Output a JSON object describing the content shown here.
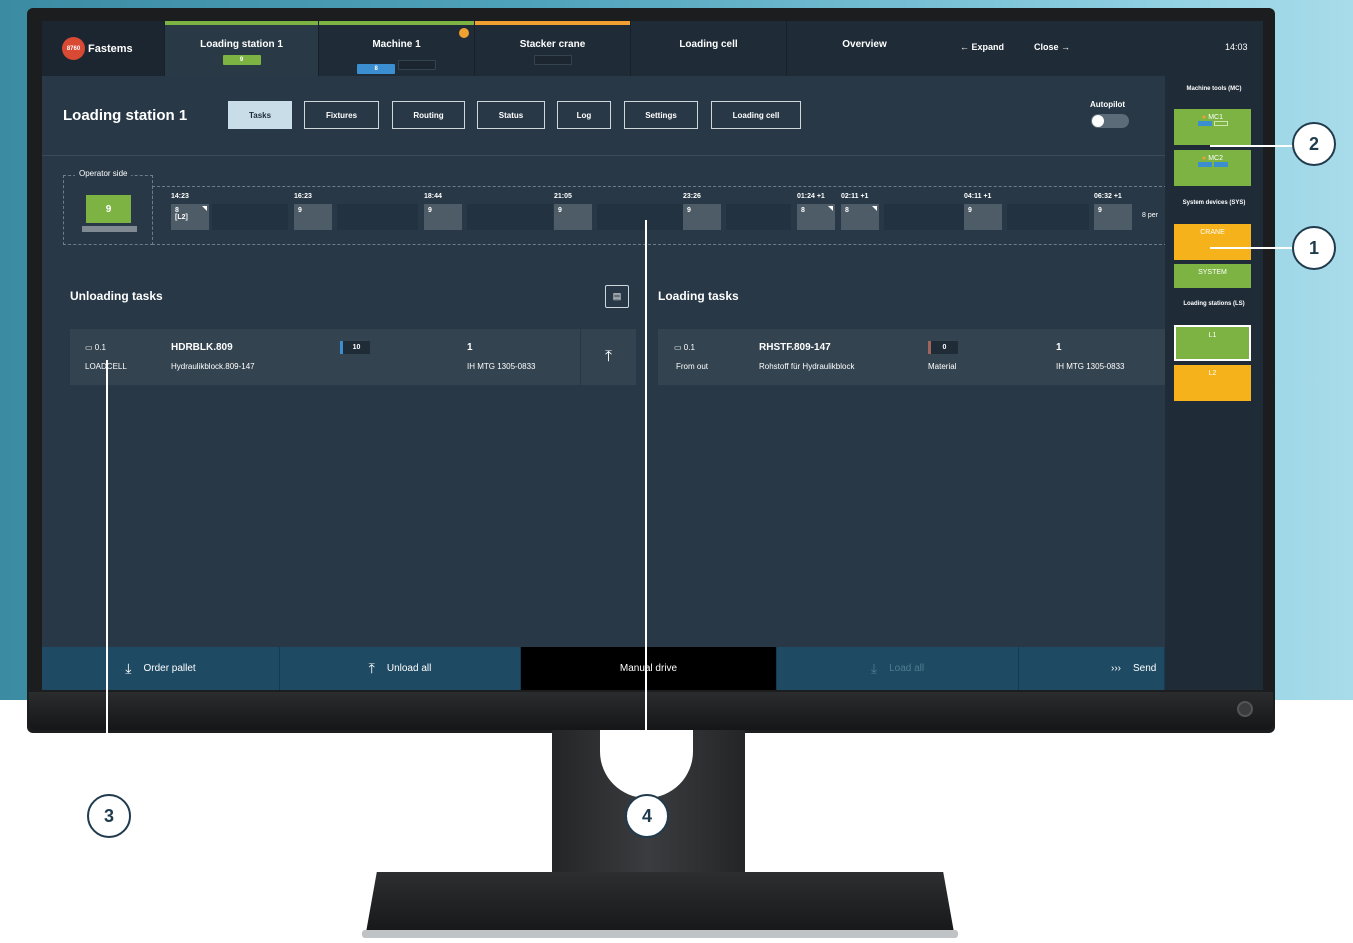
{
  "app": {
    "logo_text": "Fastems",
    "logo_badge": "8760"
  },
  "tabs": [
    {
      "label": "Loading station 1",
      "chip": "9",
      "accent": "#7cb342"
    },
    {
      "label": "Machine 1",
      "chip": "8",
      "accent": "#7cb342"
    },
    {
      "label": "Stacker crane",
      "chip": "",
      "accent": "#f0a031"
    },
    {
      "label": "Loading cell",
      "chip": ""
    },
    {
      "label": "Overview",
      "chip": ""
    }
  ],
  "nav": {
    "expand": "←  Expand",
    "close": "Close  →",
    "time": "14:03"
  },
  "header": {
    "title": "Loading station 1",
    "buttons": [
      "Tasks",
      "Fixtures",
      "Routing",
      "Status",
      "Log",
      "Settings",
      "Loading cell"
    ],
    "autopilot": "Autopilot",
    "autopilot_on": false
  },
  "timeline": {
    "operator_label": "Operator side",
    "operator_value": "9",
    "slots": [
      {
        "time": "14:23",
        "value": "8",
        "sub": "[L2]"
      },
      {
        "time": "16:23",
        "value": "9",
        "sub": ""
      },
      {
        "time": "18:44",
        "value": "9",
        "sub": ""
      },
      {
        "time": "21:05",
        "value": "9",
        "sub": ""
      },
      {
        "time": "23:26",
        "value": "9",
        "sub": ""
      },
      {
        "time": "01:24 +1",
        "value": "8",
        "sub": ""
      },
      {
        "time": "02:11 +1",
        "value": "8",
        "sub": ""
      },
      {
        "time": "04:11 +1",
        "value": "9",
        "sub": ""
      },
      {
        "time": "06:32 +1",
        "value": "9",
        "sub": ""
      }
    ],
    "overflow": "8 per"
  },
  "unloading": {
    "title": "Unloading tasks",
    "row": {
      "pos": "0.1",
      "location": "LOADCELL",
      "code": "HDRBLK.809",
      "desc": "Hydraulikblock.809-147",
      "qty": "10",
      "count": "1",
      "order": "IH MTG 1305-0833"
    }
  },
  "loading": {
    "title": "Loading tasks",
    "row": {
      "pos": "0.1",
      "location": "From out",
      "code": "RHSTF.809-147",
      "desc": "Rohstoff für Hydraulikblock",
      "qty": "0",
      "type": "Material",
      "count": "1",
      "order": "IH MTG 1305-0833"
    }
  },
  "footer": {
    "order_pallet": "Order pallet",
    "unload_all": "Unload all",
    "manual_drive": "Manual drive",
    "load_all": "Load all",
    "send": "Send"
  },
  "sidebar": {
    "mc_title": "Machine tools (MC)",
    "mc": [
      {
        "label": "MC1"
      },
      {
        "label": "MC2"
      }
    ],
    "sys_title": "System devices (SYS)",
    "sys": [
      {
        "label": "CRANE"
      },
      {
        "label": "SYSTEM"
      }
    ],
    "ls_title": "Loading stations (LS)",
    "ls": [
      {
        "label": "L1"
      },
      {
        "label": "L2"
      }
    ]
  },
  "callouts": [
    "1",
    "2",
    "3",
    "4"
  ]
}
